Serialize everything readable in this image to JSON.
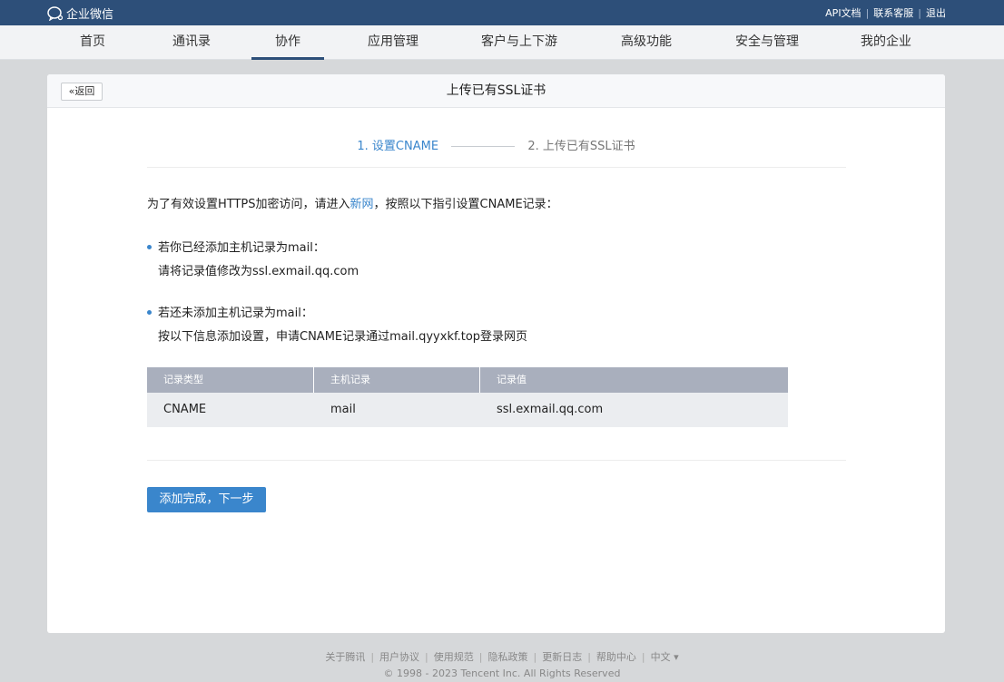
{
  "topbar": {
    "logo_text": "企业微信",
    "links": [
      "API文档",
      "联系客服",
      "退出"
    ]
  },
  "nav": {
    "items": [
      "首页",
      "通讯录",
      "协作",
      "应用管理",
      "客户与上下游",
      "高级功能",
      "安全与管理",
      "我的企业"
    ],
    "active": "协作"
  },
  "card": {
    "back_label": "«返回",
    "title": "上传已有SSL证书"
  },
  "steps": {
    "step1": "1. 设置CNAME",
    "step2": "2. 上传已有SSL证书"
  },
  "content": {
    "intro_prefix": "为了有效设置HTTPS加密访问，请进入",
    "intro_link": "新网",
    "intro_suffix": "，按照以下指引设置CNAME记录：",
    "bullet1_title": "若你已经添加主机记录为mail：",
    "bullet1_text": "请将记录值修改为ssl.exmail.qq.com",
    "bullet2_title": "若还未添加主机记录为mail：",
    "bullet2_text": "按以下信息添加设置，申请CNAME记录通过mail.qyyxkf.top登录网页"
  },
  "table": {
    "headers": [
      "记录类型",
      "主机记录",
      "记录值"
    ],
    "rows": [
      [
        "CNAME",
        "mail",
        "ssl.exmail.qq.com"
      ]
    ]
  },
  "next_button": "添加完成，下一步",
  "footer": {
    "links": [
      "关于腾讯",
      "用户协议",
      "使用规范",
      "隐私政策",
      "更新日志",
      "帮助中心",
      "中文 ▾"
    ],
    "copyright": "© 1998 - 2023 Tencent Inc. All Rights Reserved"
  },
  "colors": {
    "topbar": "#2d4f79",
    "accent": "#3a86cc",
    "table_header": "#a9afbd"
  }
}
